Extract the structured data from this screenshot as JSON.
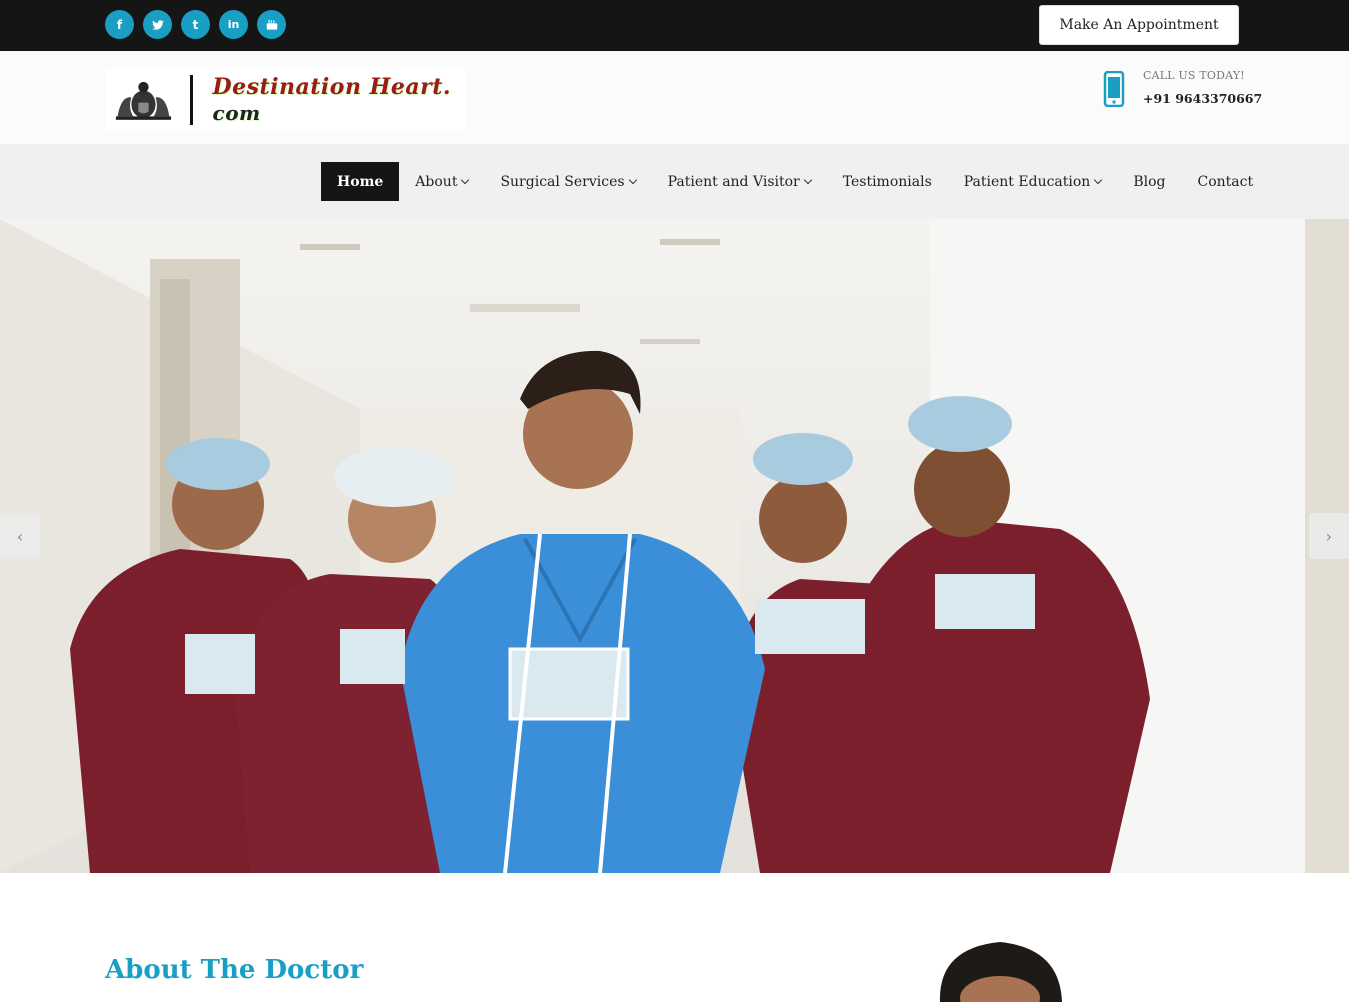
{
  "topbar": {
    "social": [
      {
        "icon": "facebook-icon",
        "glyph": "f"
      },
      {
        "icon": "twitter-icon",
        "glyph": ""
      },
      {
        "icon": "tumblr-icon",
        "glyph": "t"
      },
      {
        "icon": "linkedin-icon",
        "glyph": "in"
      },
      {
        "icon": "youtube-icon",
        "glyph": ""
      }
    ],
    "appointment_label": "Make An Appointment"
  },
  "header": {
    "brand": "Destination Heart.",
    "brand_suffix": " com",
    "call_label": "CALL US TODAY!",
    "phone": "+91 9643370667"
  },
  "nav": {
    "items": [
      {
        "label": "Home",
        "active": true,
        "dropdown": false
      },
      {
        "label": "About",
        "dropdown": true
      },
      {
        "label": "Surgical Services",
        "dropdown": true
      },
      {
        "label": "Patient and Visitor",
        "dropdown": true
      },
      {
        "label": "Testimonials",
        "dropdown": false
      },
      {
        "label": "Patient Education",
        "dropdown": true
      },
      {
        "label": "Blog",
        "dropdown": false
      },
      {
        "label": "Contact",
        "dropdown": false
      }
    ]
  },
  "slider": {
    "prev": "‹",
    "next": "›"
  },
  "about": {
    "title": "About The Doctor"
  },
  "colors": {
    "accent": "#1a9fc4",
    "dark": "#151515",
    "scrub_maroon": "#7a1f2b",
    "scrub_blue": "#3b8fd9"
  }
}
